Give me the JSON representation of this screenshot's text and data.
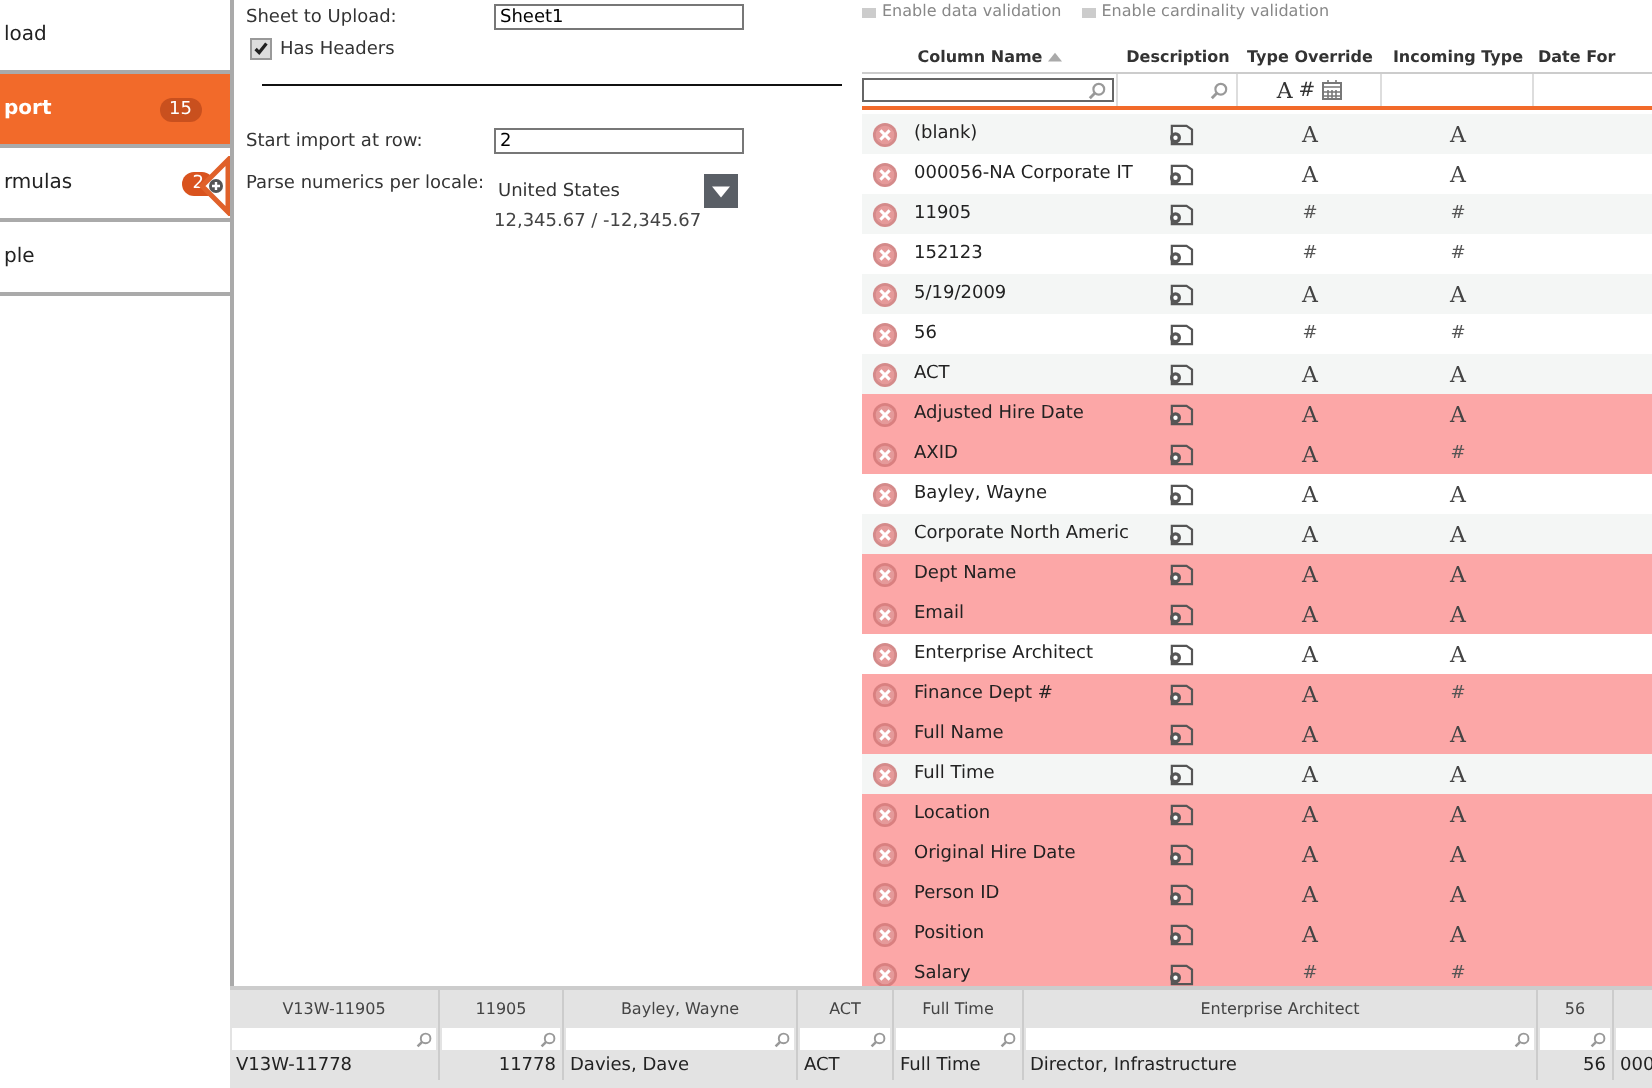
{
  "sidebar": {
    "items": [
      {
        "label": "load",
        "selected": false
      },
      {
        "label": "port",
        "selected": true,
        "badge": "15"
      },
      {
        "label": "rmulas",
        "selected": false,
        "badge": "2"
      },
      {
        "label": "ple",
        "selected": false
      }
    ]
  },
  "form": {
    "sheet_label": "Sheet to Upload:",
    "sheet_value": "Sheet1",
    "has_headers": {
      "label": "Has Headers",
      "checked": true
    },
    "start_label": "Start import at row:",
    "start_value": "2",
    "locale_label": "Parse numerics per locale:",
    "locale_value": "United States",
    "locale_example": "12,345.67 / -12,345.67"
  },
  "options": [
    {
      "label": "Enable data validation",
      "checked": false
    },
    {
      "label": "Enable cardinality validation",
      "checked": false
    }
  ],
  "grid": {
    "columns": [
      "Column Name",
      "Description",
      "Type Override",
      "Incoming Type",
      "Date For"
    ],
    "type_filter": [
      "A",
      "#"
    ],
    "rows": [
      {
        "name": "(blank)",
        "error": false,
        "type_override": "A",
        "incoming_type": "A"
      },
      {
        "name": "000056-NA Corporate IT",
        "error": false,
        "type_override": "A",
        "incoming_type": "A"
      },
      {
        "name": "11905",
        "error": false,
        "type_override": "#",
        "incoming_type": "#"
      },
      {
        "name": "152123",
        "error": false,
        "type_override": "#",
        "incoming_type": "#"
      },
      {
        "name": "5/19/2009",
        "error": false,
        "type_override": "A",
        "incoming_type": "A"
      },
      {
        "name": "56",
        "error": false,
        "type_override": "#",
        "incoming_type": "#"
      },
      {
        "name": "ACT",
        "error": false,
        "type_override": "A",
        "incoming_type": "A"
      },
      {
        "name": "Adjusted Hire Date",
        "error": true,
        "type_override": "A",
        "incoming_type": "A"
      },
      {
        "name": "AXID",
        "error": true,
        "type_override": "A",
        "incoming_type": "#"
      },
      {
        "name": "Bayley, Wayne",
        "error": false,
        "type_override": "A",
        "incoming_type": "A"
      },
      {
        "name": "Corporate North Americ",
        "error": false,
        "type_override": "A",
        "incoming_type": "A"
      },
      {
        "name": "Dept Name",
        "error": true,
        "type_override": "A",
        "incoming_type": "A"
      },
      {
        "name": "Email",
        "error": true,
        "type_override": "A",
        "incoming_type": "A"
      },
      {
        "name": "Enterprise Architect",
        "error": false,
        "type_override": "A",
        "incoming_type": "A"
      },
      {
        "name": "Finance Dept #",
        "error": true,
        "type_override": "A",
        "incoming_type": "#"
      },
      {
        "name": "Full Name",
        "error": true,
        "type_override": "A",
        "incoming_type": "A"
      },
      {
        "name": "Full Time",
        "error": false,
        "type_override": "A",
        "incoming_type": "A"
      },
      {
        "name": "Location",
        "error": true,
        "type_override": "A",
        "incoming_type": "A"
      },
      {
        "name": "Original Hire Date",
        "error": true,
        "type_override": "A",
        "incoming_type": "A"
      },
      {
        "name": "Person ID",
        "error": true,
        "type_override": "A",
        "incoming_type": "A"
      },
      {
        "name": "Position",
        "error": true,
        "type_override": "A",
        "incoming_type": "A"
      },
      {
        "name": "Salary",
        "error": true,
        "type_override": "#",
        "incoming_type": "#"
      }
    ]
  },
  "preview": {
    "columns": [
      "V13W-11905",
      "11905",
      "Bayley, Wayne",
      "ACT",
      "Full Time",
      "Enterprise Architect",
      "56",
      ""
    ],
    "rows": [
      [
        "V13W-11778",
        "11778",
        "Davies, Dave",
        "ACT",
        "Full Time",
        "Director, Infrastructure",
        "56",
        "000"
      ]
    ]
  }
}
